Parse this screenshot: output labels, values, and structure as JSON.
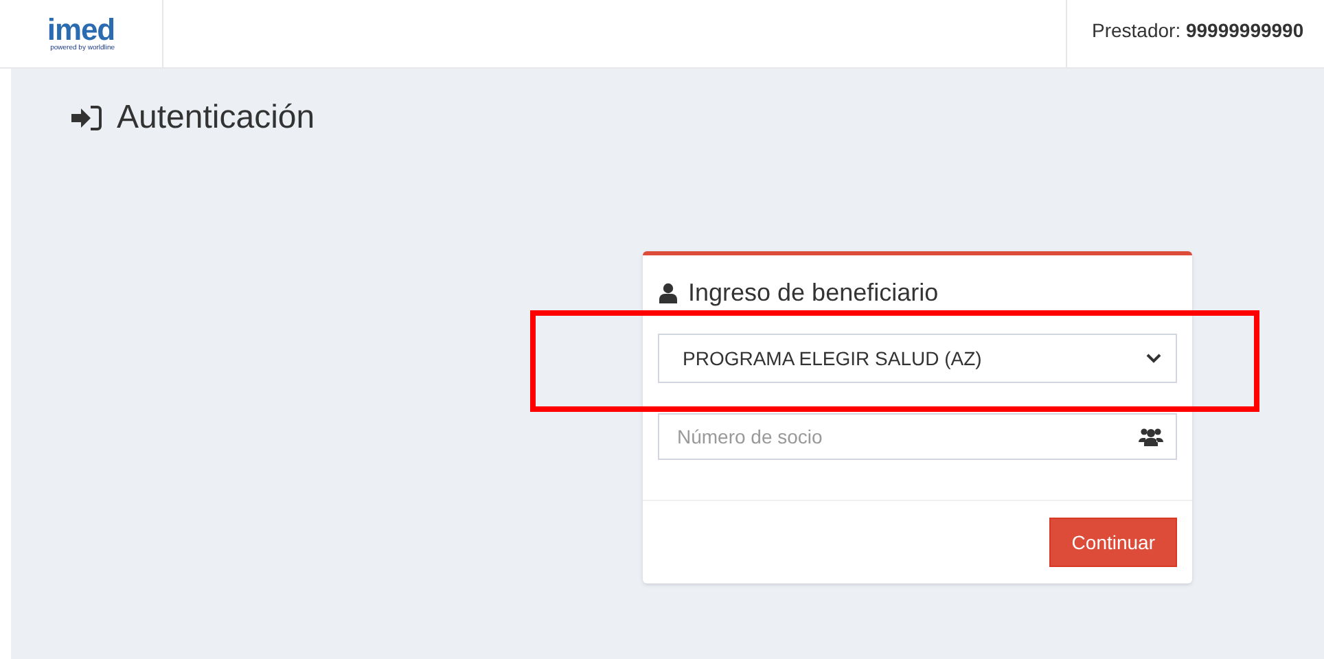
{
  "header": {
    "logo": {
      "wordmark": "imed",
      "tagline": "powered by worldline"
    },
    "provider_label": "Prestador:",
    "provider_id": "99999999990"
  },
  "page_title": "Autenticación",
  "card": {
    "title": "Ingreso de beneficiario",
    "plan_select": {
      "value": "PROGRAMA ELEGIR SALUD (AZ)",
      "highlighted": true
    },
    "member_field": {
      "placeholder": "Número de socio"
    },
    "buttons": [
      {
        "label": "Continuar"
      }
    ]
  }
}
